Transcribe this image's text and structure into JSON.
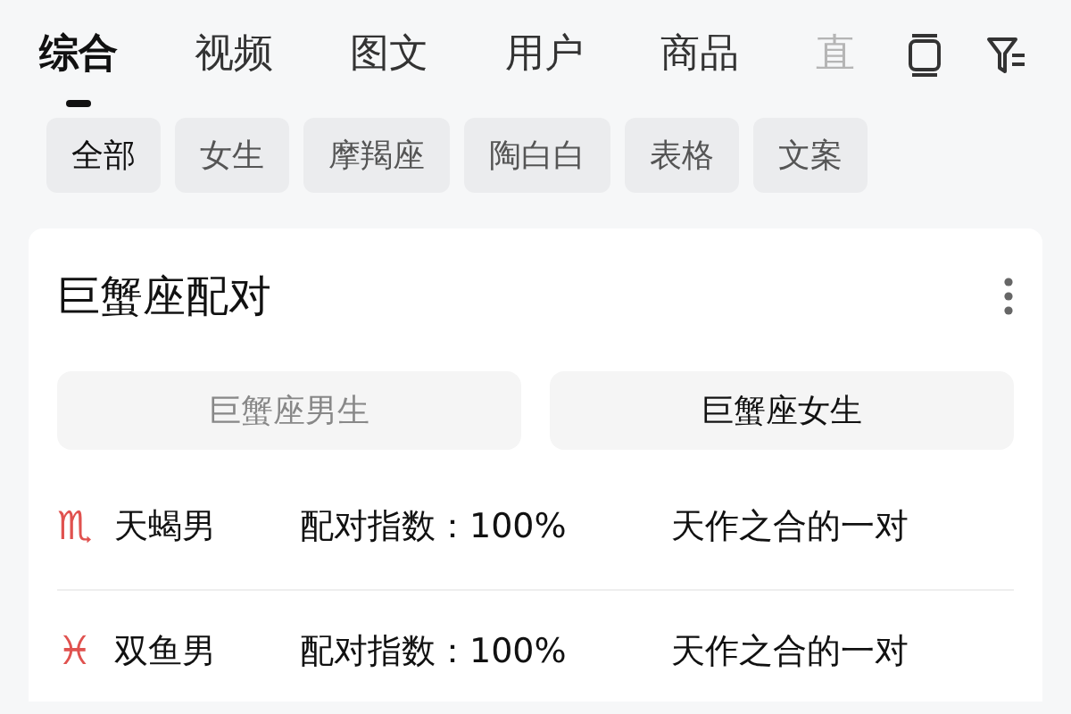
{
  "tabs": [
    {
      "label": "综合",
      "selected": true
    },
    {
      "label": "视频",
      "selected": false
    },
    {
      "label": "图文",
      "selected": false
    },
    {
      "label": "用户",
      "selected": false
    },
    {
      "label": "商品",
      "selected": false
    },
    {
      "label": "直",
      "selected": false,
      "faded": true
    }
  ],
  "chips": [
    {
      "label": "全部",
      "selected": true
    },
    {
      "label": "女生",
      "selected": false
    },
    {
      "label": "摩羯座",
      "selected": false
    },
    {
      "label": "陶白白",
      "selected": false
    },
    {
      "label": "表格",
      "selected": false
    },
    {
      "label": "文案",
      "selected": false
    }
  ],
  "card": {
    "title": "巨蟹座配对",
    "segments": [
      {
        "label": "巨蟹座男生",
        "selected": false
      },
      {
        "label": "巨蟹座女生",
        "selected": true
      }
    ],
    "rows": [
      {
        "sign": "♏",
        "name": "天蝎男",
        "score": "配对指数：100%",
        "verdict": "天作之合的一对"
      },
      {
        "sign": "♓",
        "name": "双鱼男",
        "score": "配对指数：100%",
        "verdict": "天作之合的一对"
      }
    ]
  }
}
